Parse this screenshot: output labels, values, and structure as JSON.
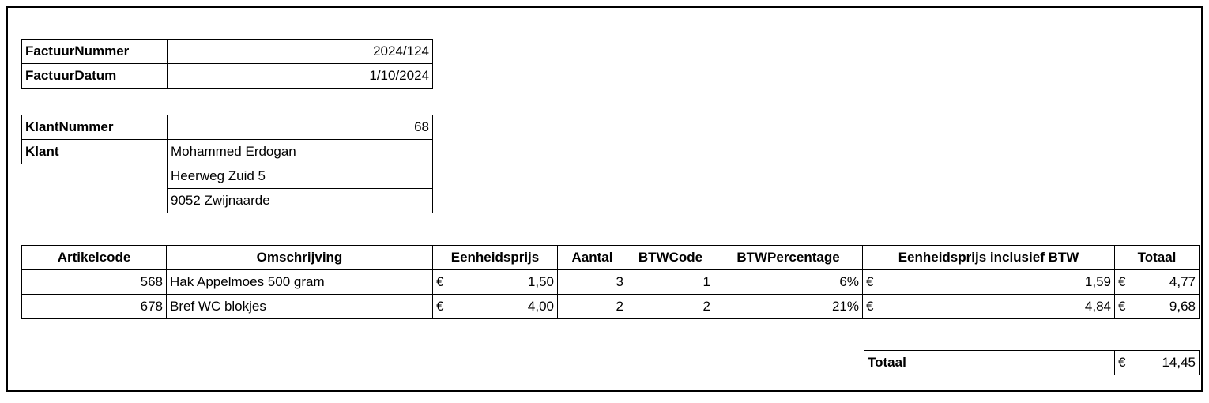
{
  "invoice": {
    "number_label": "FactuurNummer",
    "number_value": "2024/124",
    "date_label": "FactuurDatum",
    "date_value": "1/10/2024"
  },
  "customer": {
    "number_label": "KlantNummer",
    "number_value": "68",
    "name_label": "Klant",
    "name": "Mohammed Erdogan",
    "street": "Heerweg Zuid 5",
    "city": "9052 Zwijnaarde"
  },
  "lines": {
    "headers": [
      "Artikelcode",
      "Omschrijving",
      "Eenheidsprijs",
      "Aantal",
      "BTWCode",
      "BTWPercentage",
      "Eenheidsprijs inclusief BTW",
      "Totaal"
    ],
    "currency": "€",
    "rows": [
      {
        "code": "568",
        "desc": "Hak Appelmoes 500 gram",
        "unit": "1,50",
        "qty": "3",
        "vat_code": "1",
        "vat_pct": "6%",
        "unit_incl": "1,59",
        "total": "4,77"
      },
      {
        "code": "678",
        "desc": "Bref WC blokjes",
        "unit": "4,00",
        "qty": "2",
        "vat_code": "2",
        "vat_pct": "21%",
        "unit_incl": "4,84",
        "total": "9,68"
      }
    ]
  },
  "grand_total": {
    "label": "Totaal",
    "value": "14,45"
  }
}
